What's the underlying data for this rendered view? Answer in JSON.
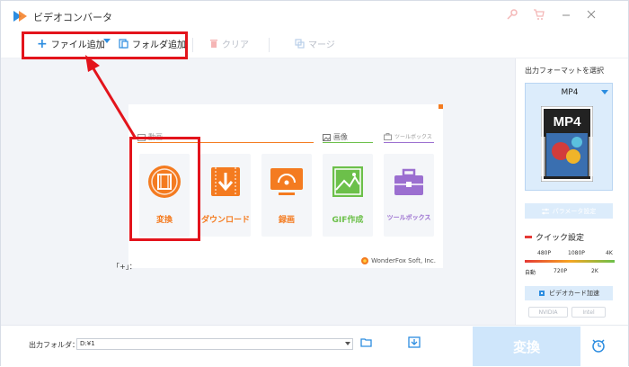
{
  "app": {
    "title": "ビデオコンバータ"
  },
  "toolbar": {
    "add_file": "ファイル追加",
    "add_folder": "フォルダ追加",
    "clear": "クリア",
    "merge": "マージ"
  },
  "categories": {
    "video": "動画",
    "image": "画像",
    "toolbox": "ツールボックス"
  },
  "tiles": {
    "convert": "変換",
    "download": "ダウンロード",
    "record": "録画",
    "gif": "GIF作成",
    "toolbox": "ツールボックス"
  },
  "brand": "WonderFox Soft, Inc.",
  "plus_hint": "「+」：",
  "right_panel": {
    "output_format_title": "出力フォーマットを選択",
    "format": "MP4",
    "format_badge": "MP4",
    "param_button": "パラメータ設定",
    "quick_settings": "クイック設定",
    "quality_top": [
      "480P",
      "1080P",
      "4K"
    ],
    "quality_bottom": [
      "自動",
      "720P",
      "2K"
    ],
    "gpu_button": "ビデオカード加速",
    "nvidia": "NVIDIA",
    "intel": "Intel"
  },
  "bottom": {
    "output_folder_label": "出力フォルダ：",
    "path": "D:¥1",
    "convert_button": "変換"
  },
  "colors": {
    "accent_orange": "#f47b20",
    "highlight_red": "#e3141c",
    "blue": "#2c8de0",
    "green": "#6cc04a",
    "purple": "#9b6fd0"
  }
}
